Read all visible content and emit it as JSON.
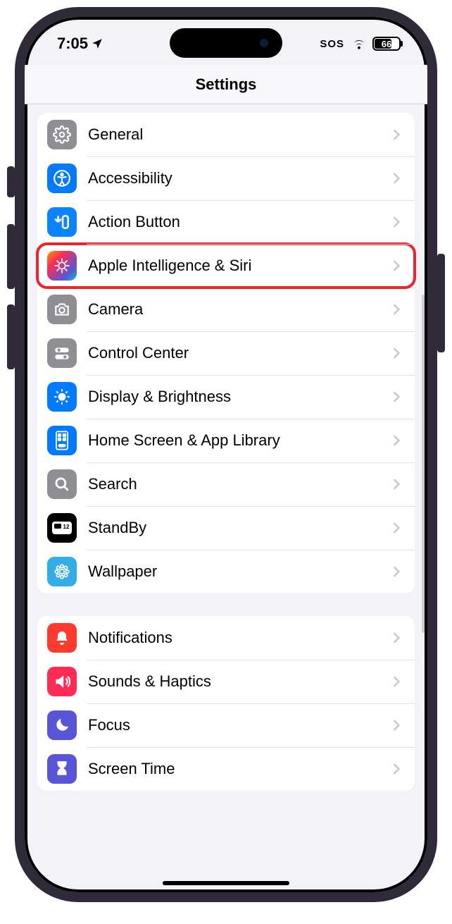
{
  "statusbar": {
    "time": "7:05",
    "sos": "SOS",
    "battery_level": "66"
  },
  "navbar": {
    "title": "Settings"
  },
  "group1": {
    "items": [
      {
        "label": "General",
        "icon": "general-icon",
        "highlighted": false
      },
      {
        "label": "Accessibility",
        "icon": "accessibility-icon",
        "highlighted": false
      },
      {
        "label": "Action Button",
        "icon": "action-button-icon",
        "highlighted": false
      },
      {
        "label": "Apple Intelligence & Siri",
        "icon": "intelligence-icon",
        "highlighted": true
      },
      {
        "label": "Camera",
        "icon": "camera-icon",
        "highlighted": false
      },
      {
        "label": "Control Center",
        "icon": "control-center-icon",
        "highlighted": false
      },
      {
        "label": "Display & Brightness",
        "icon": "brightness-icon",
        "highlighted": false
      },
      {
        "label": "Home Screen & App Library",
        "icon": "homescreen-icon",
        "highlighted": false
      },
      {
        "label": "Search",
        "icon": "search-icon",
        "highlighted": false
      },
      {
        "label": "StandBy",
        "icon": "standby-icon",
        "highlighted": false
      },
      {
        "label": "Wallpaper",
        "icon": "wallpaper-icon",
        "highlighted": false
      }
    ]
  },
  "group2": {
    "items": [
      {
        "label": "Notifications",
        "icon": "notifications-icon"
      },
      {
        "label": "Sounds & Haptics",
        "icon": "sounds-icon"
      },
      {
        "label": "Focus",
        "icon": "focus-icon"
      },
      {
        "label": "Screen Time",
        "icon": "screentime-icon"
      }
    ]
  }
}
